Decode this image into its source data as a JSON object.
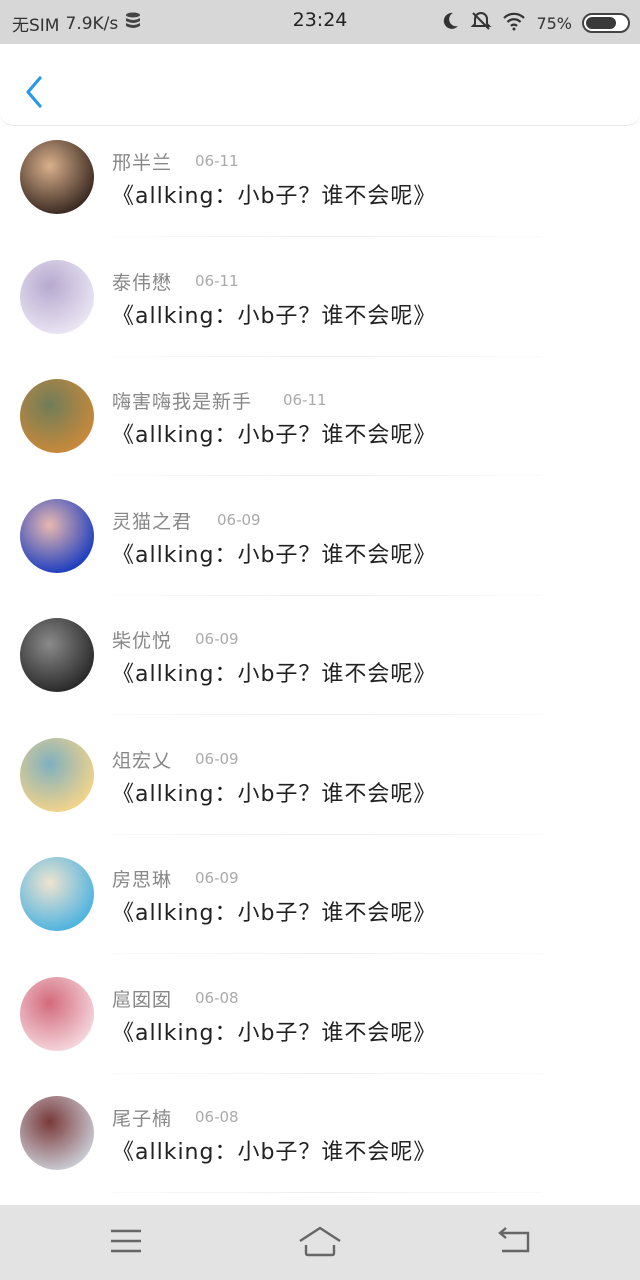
{
  "status_bar": {
    "carrier": "无SIM",
    "speed": "7.9K/s",
    "time": "23:24",
    "battery": "75%",
    "battery_level": 0.75
  },
  "messages": [
    {
      "name": "邢半兰",
      "date": "06-11",
      "text": "《allking：小b子？谁不会呢》",
      "colors": [
        "#3b2a22",
        "#d9b08c"
      ]
    },
    {
      "name": "泰伟懋",
      "date": "06-11",
      "text": "《allking：小b子？谁不会呢》",
      "colors": [
        "#e9e4f2",
        "#b7a9cf"
      ]
    },
    {
      "name": "嗨害嗨我是新手",
      "date": "06-11",
      "text": "《allking：小b子？谁不会呢》",
      "colors": [
        "#c8893a",
        "#6f7d5a"
      ]
    },
    {
      "name": "灵猫之君",
      "date": "06-09",
      "text": "《allking：小b子？谁不会呢》",
      "colors": [
        "#1f3fbf",
        "#e8b8b0"
      ]
    },
    {
      "name": "柴优悦",
      "date": "06-09",
      "text": "《allking：小b子？谁不会呢》",
      "colors": [
        "#2a2a2a",
        "#8a8a8a"
      ]
    },
    {
      "name": "俎宏乂",
      "date": "06-09",
      "text": "《allking：小b子？谁不会呢》",
      "colors": [
        "#f2d38a",
        "#7fb0c0"
      ]
    },
    {
      "name": "房思琳",
      "date": "06-09",
      "text": "《allking：小b子？谁不会呢》",
      "colors": [
        "#4fb3e0",
        "#efe4cf"
      ]
    },
    {
      "name": "扈囡囡",
      "date": "06-08",
      "text": "《allking：小b子？谁不会呢》",
      "colors": [
        "#f4d4da",
        "#d36a7c"
      ]
    },
    {
      "name": "尾子楠",
      "date": "06-08",
      "text": "《allking：小b子？谁不会呢》",
      "colors": [
        "#c9c9d2",
        "#7a3a3a"
      ]
    }
  ]
}
